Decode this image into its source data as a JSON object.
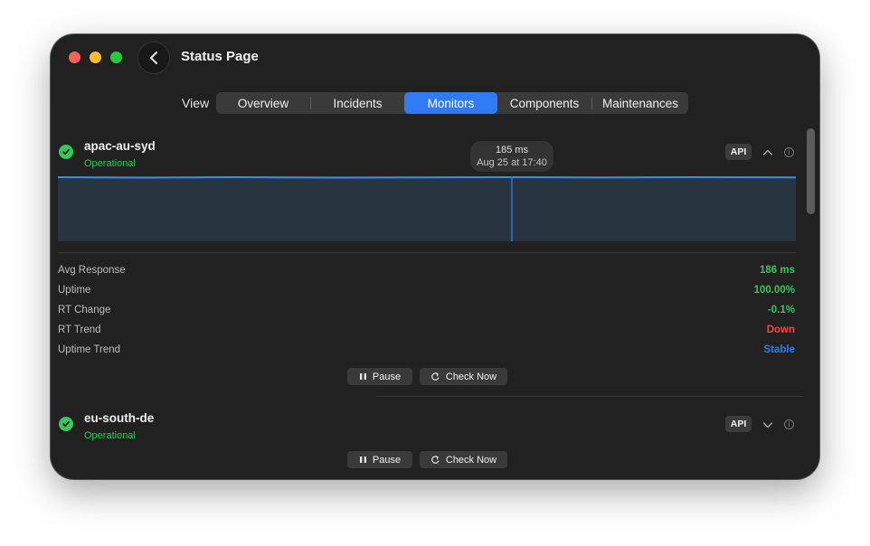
{
  "window": {
    "title": "Status Page"
  },
  "nav": {
    "view_label": "View",
    "tabs": [
      {
        "label": "Overview",
        "active": false
      },
      {
        "label": "Incidents",
        "active": false
      },
      {
        "label": "Monitors",
        "active": true
      },
      {
        "label": "Components",
        "active": false
      },
      {
        "label": "Maintenances",
        "active": false
      }
    ]
  },
  "monitors": [
    {
      "name": "apac-au-syd",
      "status": "Operational",
      "badge": "API",
      "expanded": true,
      "tooltip": {
        "value": "185 ms",
        "time": "Aug 25 at 17:40"
      },
      "stats": [
        {
          "label": "Avg Response",
          "value": "186 ms",
          "color": "#34c759"
        },
        {
          "label": "Uptime",
          "value": "100.00%",
          "color": "#34c759"
        },
        {
          "label": "RT Change",
          "value": "-0.1%",
          "color": "#34c759"
        },
        {
          "label": "RT Trend",
          "value": "Down",
          "color": "#ff453a"
        },
        {
          "label": "Uptime Trend",
          "value": "Stable",
          "color": "#2f7bf5"
        }
      ],
      "pause_label": "Pause",
      "check_label": "Check Now"
    },
    {
      "name": "eu-south-de",
      "status": "Operational",
      "badge": "API",
      "expanded": false,
      "pause_label": "Pause",
      "check_label": "Check Now"
    }
  ],
  "colors": {
    "accent": "#2f7bf5",
    "success": "#34c759",
    "danger": "#ff453a",
    "background": "#212121"
  },
  "icons": [
    "back-chevron-icon",
    "check-circle-icon",
    "chevron-up-icon",
    "chevron-down-icon",
    "info-icon",
    "pause-icon",
    "refresh-icon"
  ]
}
